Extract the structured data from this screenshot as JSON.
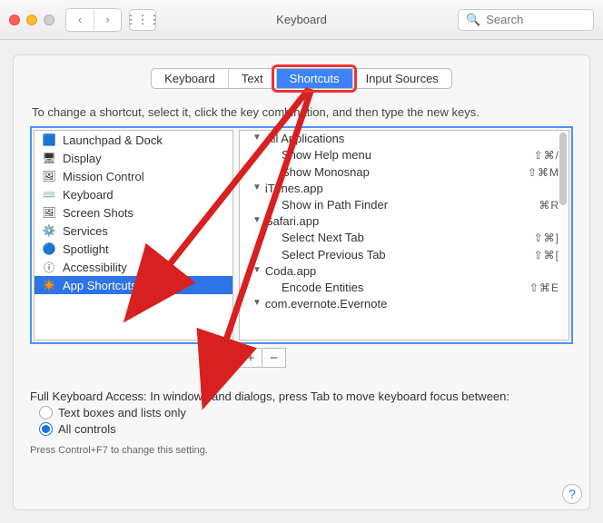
{
  "window": {
    "title": "Keyboard",
    "search_placeholder": "Search",
    "help": "?"
  },
  "tabs": [
    {
      "id": "keyboard",
      "label": "Keyboard"
    },
    {
      "id": "text",
      "label": "Text"
    },
    {
      "id": "shortcuts",
      "label": "Shortcuts",
      "active": true
    },
    {
      "id": "inputsources",
      "label": "Input Sources"
    }
  ],
  "instruction": "To change a shortcut, select it, click the key combination, and then type the new keys.",
  "categories": [
    {
      "label": "Launchpad & Dock",
      "icon": "🟦",
      "iconName": "launchpad-icon"
    },
    {
      "label": "Display",
      "icon": "🖥",
      "iconName": "display-icon"
    },
    {
      "label": "Mission Control",
      "icon": "🖼",
      "iconName": "mission-control-icon"
    },
    {
      "label": "Keyboard",
      "icon": "⌨️",
      "iconName": "keyboard-icon"
    },
    {
      "label": "Screen Shots",
      "icon": "🖼",
      "iconName": "screenshots-icon"
    },
    {
      "label": "Services",
      "icon": "⚙️",
      "iconName": "services-icon"
    },
    {
      "label": "Spotlight",
      "icon": "🔵",
      "iconName": "spotlight-icon"
    },
    {
      "label": "Accessibility",
      "icon": "ⓘ",
      "iconName": "accessibility-icon"
    },
    {
      "label": "App Shortcuts",
      "icon": "✴️",
      "iconName": "app-shortcuts-icon",
      "selected": true
    }
  ],
  "shortcuts": {
    "groups": [
      {
        "name": "All Applications",
        "items": [
          {
            "label": "Show Help menu",
            "keys": "⇧⌘/"
          },
          {
            "label": "Show Monosnap",
            "keys": "⇧⌘M"
          }
        ]
      },
      {
        "name": "iTunes.app",
        "items": [
          {
            "label": "Show in Path Finder",
            "keys": "⌘R"
          }
        ]
      },
      {
        "name": "Safari.app",
        "items": [
          {
            "label": "Select Next Tab",
            "keys": "⇧⌘]"
          },
          {
            "label": "Select Previous Tab",
            "keys": "⇧⌘["
          }
        ]
      },
      {
        "name": "Coda.app",
        "items": [
          {
            "label": "Encode Entities",
            "keys": "⇧⌘E"
          }
        ]
      },
      {
        "name": "com.evernote.Evernote",
        "items": []
      }
    ]
  },
  "buttons": {
    "add": "+",
    "remove": "−"
  },
  "fullKeyboardAccess": {
    "label": "Full Keyboard Access: In windows and dialogs, press Tab to move keyboard focus between:",
    "options": [
      {
        "label": "Text boxes and lists only",
        "checked": false
      },
      {
        "label": "All controls",
        "checked": true
      }
    ],
    "hint": "Press Control+F7 to change this setting."
  }
}
